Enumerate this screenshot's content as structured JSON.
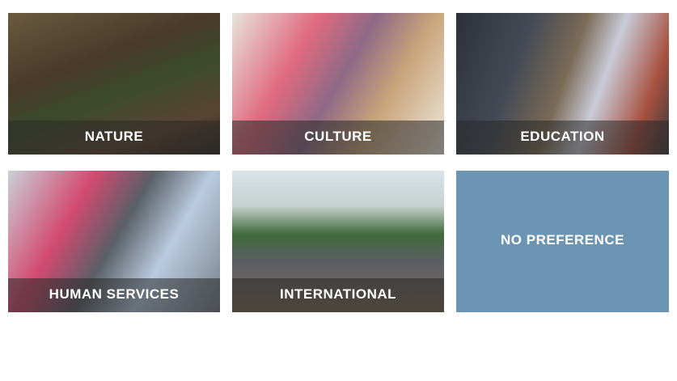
{
  "options": [
    {
      "id": "nature",
      "label": "NATURE"
    },
    {
      "id": "culture",
      "label": "CULTURE"
    },
    {
      "id": "education",
      "label": "EDUCATION"
    },
    {
      "id": "human-services",
      "label": "HUMAN SERVICES"
    },
    {
      "id": "international",
      "label": "INTERNATIONAL"
    },
    {
      "id": "no-preference",
      "label": "NO PREFERENCE"
    }
  ],
  "colors": {
    "no_preference_bg": "#6c95b3",
    "label_text": "#ffffff",
    "label_band": "rgba(40,40,40,0.55)"
  }
}
